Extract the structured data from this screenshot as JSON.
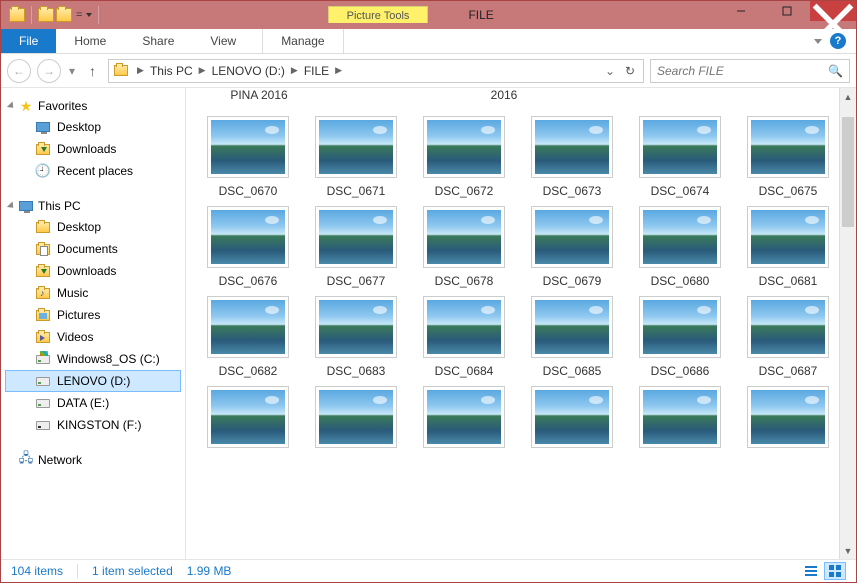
{
  "titlebar": {
    "window_title": "FILE",
    "contextual_label": "Picture Tools"
  },
  "tabs": {
    "file": "File",
    "home": "Home",
    "share": "Share",
    "view": "View",
    "manage": "Manage"
  },
  "address": {
    "root": "This PC",
    "seg1": "LENOVO (D:)",
    "seg2": "FILE"
  },
  "search": {
    "placeholder": "Search FILE"
  },
  "nav": {
    "favorites": "Favorites",
    "fav_items": [
      "Desktop",
      "Downloads",
      "Recent places"
    ],
    "this_pc": "This PC",
    "pc_items": [
      "Desktop",
      "Documents",
      "Downloads",
      "Music",
      "Pictures",
      "Videos",
      "Windows8_OS (C:)",
      "LENOVO (D:)",
      "DATA (E:)",
      "KINGSTON (F:)"
    ],
    "network": "Network"
  },
  "partial": {
    "a": "PINA 2016",
    "b": "2016"
  },
  "files": [
    "DSC_0670",
    "DSC_0671",
    "DSC_0672",
    "DSC_0673",
    "DSC_0674",
    "DSC_0675",
    "DSC_0676",
    "DSC_0677",
    "DSC_0678",
    "DSC_0679",
    "DSC_0680",
    "DSC_0681",
    "DSC_0682",
    "DSC_0683",
    "DSC_0684",
    "DSC_0685",
    "DSC_0686",
    "DSC_0687",
    "",
    "",
    "",
    "",
    "",
    ""
  ],
  "status": {
    "count": "104 items",
    "selected": "1 item selected",
    "size": "1.99 MB"
  }
}
